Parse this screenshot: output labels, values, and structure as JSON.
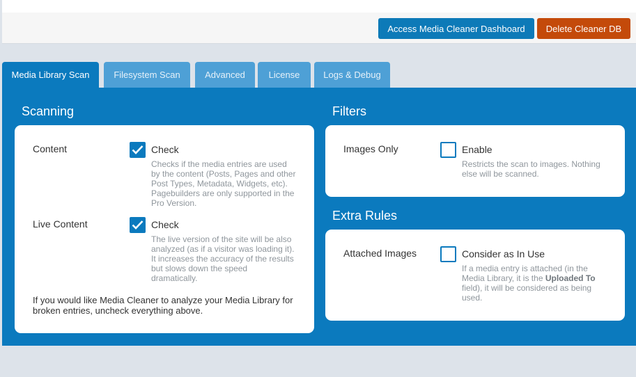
{
  "header": {
    "dashboard_button": "Access Media Cleaner Dashboard",
    "delete_button": "Delete Cleaner DB"
  },
  "tabs": [
    {
      "label": "Media Library Scan",
      "active": true
    },
    {
      "label": "Filesystem Scan",
      "active": false
    },
    {
      "label": "Advanced",
      "active": false
    },
    {
      "label": "License",
      "active": false
    },
    {
      "label": "Logs & Debug",
      "active": false
    }
  ],
  "scanning": {
    "title": "Scanning",
    "content": {
      "label": "Content",
      "checked": true,
      "check_label": "Check",
      "description": [
        "Checks if the media entries are used",
        "by the content (Posts, Pages and other",
        "Post Types, Metadata, Widgets, etc).",
        "Pagebuilders are only supported in the",
        "Pro Version."
      ]
    },
    "live_content": {
      "label": "Live Content",
      "checked": true,
      "check_label": "Check",
      "description": [
        "The live version of the site will be also",
        "analyzed (as if a visitor was loading it).",
        "It increases the accuracy of the results",
        "but slows down the speed",
        "dramatically."
      ]
    },
    "note": [
      "If you would like Media Cleaner to analyze your Media Library for",
      "broken entries, uncheck everything above."
    ]
  },
  "filters": {
    "title": "Filters",
    "images_only": {
      "label": "Images Only",
      "checked": false,
      "check_label": "Enable",
      "description": [
        "Restricts the scan to images. Nothing",
        "else will be scanned."
      ]
    }
  },
  "extra_rules": {
    "title": "Extra Rules",
    "attached_images": {
      "label": "Attached Images",
      "checked": false,
      "check_label": "Consider as In Use",
      "description_line1": "If a media entry is attached (in the",
      "description_line2_pre": "Media Library, it is the ",
      "description_line2_bold": "Uploaded To",
      "description_line3": "field), it will be considered as being",
      "description_line4": "used."
    }
  },
  "colors": {
    "primary": "#0b7abe",
    "tab_inactive": "#4ea0d6",
    "danger": "#c44a0a",
    "background": "#dde3ea"
  }
}
